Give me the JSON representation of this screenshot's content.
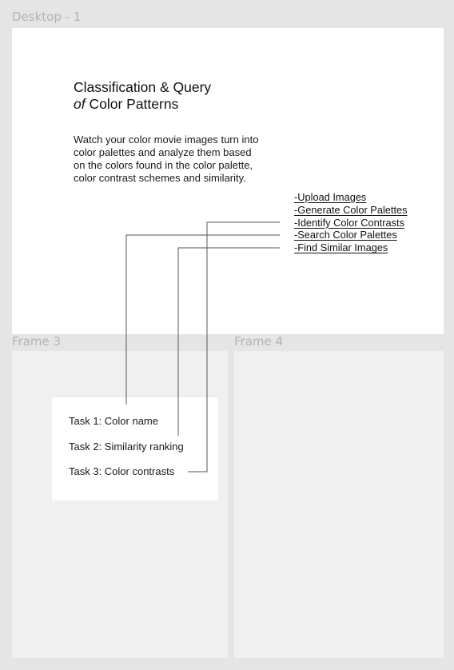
{
  "frames": {
    "desktop": {
      "label": "Desktop - 1"
    },
    "frame3": {
      "label": "Frame 3"
    },
    "frame4": {
      "label": "Frame 4"
    }
  },
  "intro": {
    "title_line1": "Classification & Query",
    "title_line2_em": "of",
    "title_line2_rest": " Color Patterns",
    "description": "Watch your color movie images turn into color palettes and analyze them based on the colors found in the color palette, color contrast schemes and similarity."
  },
  "menu": {
    "items": [
      {
        "label": "-Upload Images"
      },
      {
        "label": "-Generate Color Palettes"
      },
      {
        "label": "-Identify Color Contrasts"
      },
      {
        "label": "-Search Color Palettes"
      },
      {
        "label": "-Find Similar Images"
      }
    ]
  },
  "tasks": {
    "items": [
      {
        "label": "Task 1: Color name"
      },
      {
        "label": "Task 2: Similarity ranking"
      },
      {
        "label": "Task 3: Color contrasts"
      }
    ]
  },
  "colors": {
    "background": "#e5e5e5",
    "frame_white": "#ffffff",
    "frame_gray": "#f0f0f0",
    "connector": "#555555",
    "frame_label": "#b3b3b3"
  }
}
